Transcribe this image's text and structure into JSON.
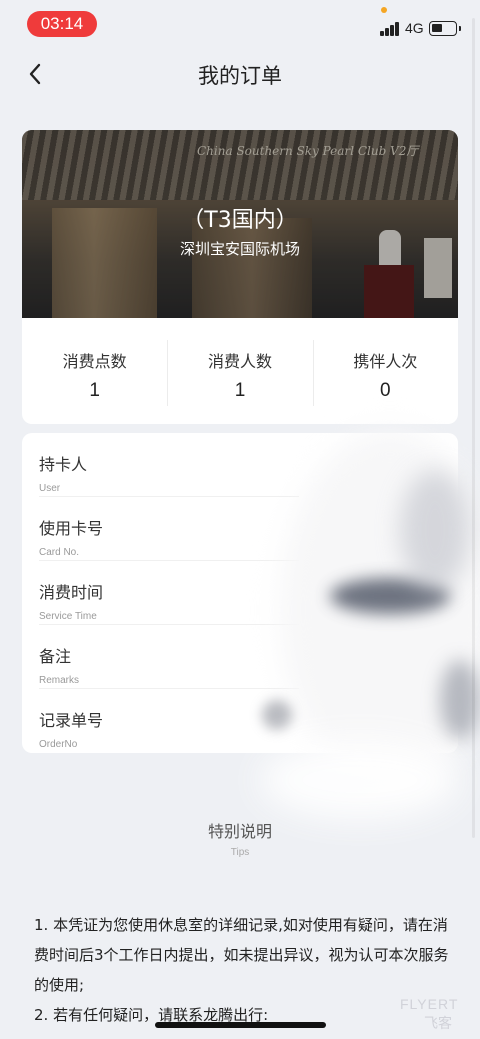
{
  "status_bar": {
    "time": "03:14",
    "network": "4G"
  },
  "header": {
    "title": "我的订单"
  },
  "lounge": {
    "name": "（T3国内）",
    "airport": "深圳宝安国际机场",
    "sign_text": "China Southern Sky Pearl Club V2厅"
  },
  "stats": [
    {
      "label": "消费点数",
      "value": "1"
    },
    {
      "label": "消费人数",
      "value": "1"
    },
    {
      "label": "携伴人次",
      "value": "0"
    }
  ],
  "fields": [
    {
      "label": "持卡人",
      "sub": "User"
    },
    {
      "label": "使用卡号",
      "sub": "Card No."
    },
    {
      "label": "消费时间",
      "sub": "Service Time"
    },
    {
      "label": "备注",
      "sub": "Remarks"
    },
    {
      "label": "记录单号",
      "sub": "OrderNo"
    }
  ],
  "tips": {
    "title": "特别说明",
    "subtitle": "Tips",
    "notes": [
      "1. 本凭证为您使用休息室的详细记录,如对使用有疑问，请在消费时间后3个工作日内提出，如未提出异议，视为认可本次服务的使用;",
      "2. 若有任何疑问，请联系龙腾出行:"
    ]
  },
  "watermark": {
    "line1": "FLYERT",
    "line2": "飞客"
  }
}
